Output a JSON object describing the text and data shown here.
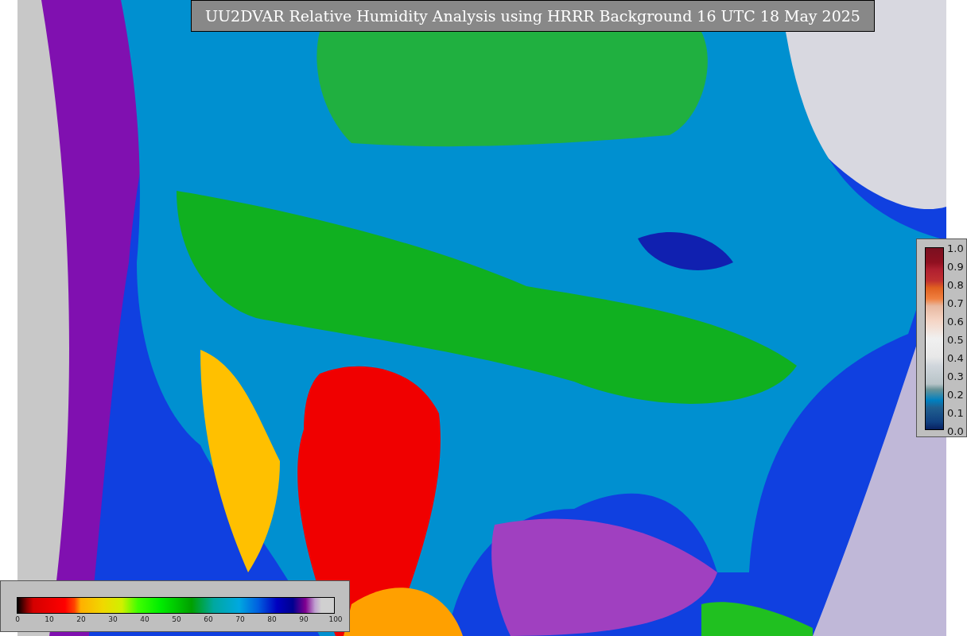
{
  "title": "UU2DVAR Relative Humidity Analysis using HRRR Background 16 UTC 18 May 2025",
  "humidity_colorbar": {
    "ticks": [
      "0",
      "10",
      "20",
      "30",
      "40",
      "50",
      "60",
      "70",
      "80",
      "90",
      "100"
    ]
  },
  "fraction_colorbar": {
    "ticks": [
      "1.0",
      "0.9",
      "0.8",
      "0.7",
      "0.6",
      "0.5",
      "0.4",
      "0.3",
      "0.2",
      "0.1",
      "0.0"
    ]
  }
}
